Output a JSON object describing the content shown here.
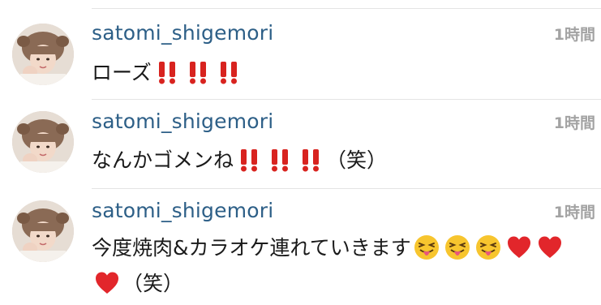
{
  "comments": [
    {
      "username": "satomi_shigemori",
      "time": "1時間",
      "text": "ローズ",
      "suffix_emojis": [
        "double-exclamation-icon",
        "double-exclamation-icon",
        "double-exclamation-icon"
      ],
      "tail": ""
    },
    {
      "username": "satomi_shigemori",
      "time": "1時間",
      "text": "なんかゴメンね",
      "suffix_emojis": [
        "double-exclamation-icon",
        "double-exclamation-icon",
        "double-exclamation-icon"
      ],
      "tail": "（笑）"
    },
    {
      "username": "satomi_shigemori",
      "time": "1時間",
      "text": "今度焼肉&カラオケ連れていきます",
      "suffix_emojis": [
        "squinting-tongue-face-icon",
        "squinting-tongue-face-icon",
        "squinting-tongue-face-icon",
        "red-heart-icon",
        "red-heart-icon",
        "red-heart-icon"
      ],
      "tail": "（笑）"
    }
  ],
  "colors": {
    "username": "#2d5f87",
    "timestamp": "#a3a3a3",
    "text": "#1a1a1a",
    "divider": "#e4e4e4"
  }
}
